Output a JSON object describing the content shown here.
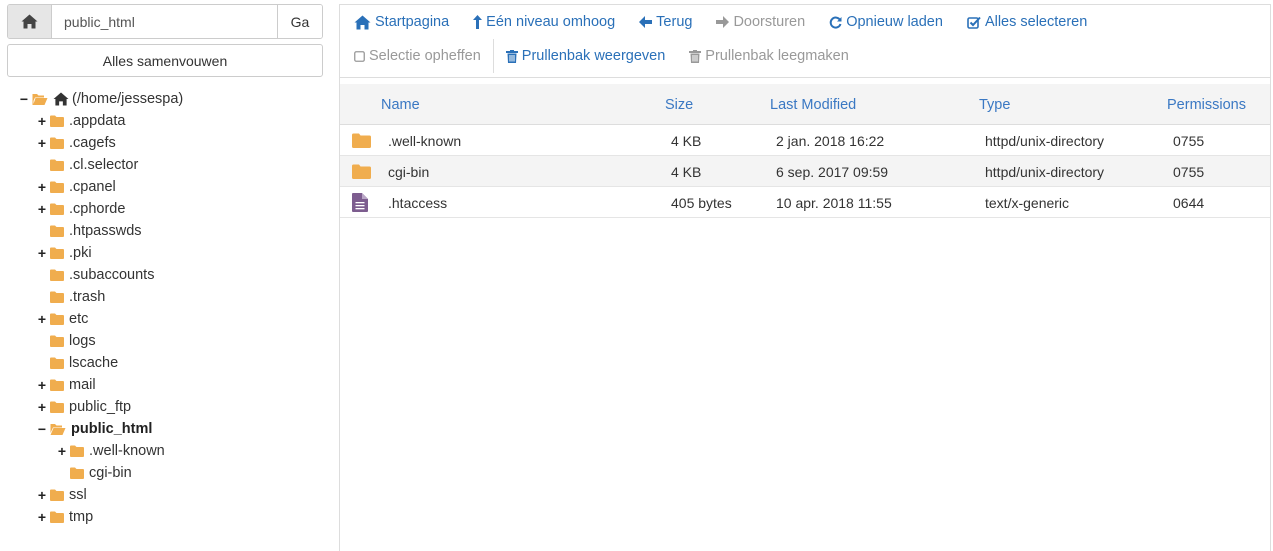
{
  "path_bar": {
    "home_icon": "home-icon",
    "path_value": "public_html",
    "go_label": "Ga"
  },
  "collapse_all_label": "Alles samenvouwen",
  "tree": {
    "root": "(/home/jessespa)",
    "items": [
      {
        "label": ".appdata",
        "toggle": "+"
      },
      {
        "label": ".cagefs",
        "toggle": "+"
      },
      {
        "label": ".cl.selector",
        "toggle": ""
      },
      {
        "label": ".cpanel",
        "toggle": "+"
      },
      {
        "label": ".cphorde",
        "toggle": "+"
      },
      {
        "label": ".htpasswds",
        "toggle": ""
      },
      {
        "label": ".pki",
        "toggle": "+"
      },
      {
        "label": ".subaccounts",
        "toggle": ""
      },
      {
        "label": ".trash",
        "toggle": ""
      },
      {
        "label": "etc",
        "toggle": "+"
      },
      {
        "label": "logs",
        "toggle": ""
      },
      {
        "label": "lscache",
        "toggle": ""
      },
      {
        "label": "mail",
        "toggle": "+"
      },
      {
        "label": "public_ftp",
        "toggle": "+"
      },
      {
        "label": "public_html",
        "toggle": "−"
      },
      {
        "label": ".well-known",
        "toggle": "+"
      },
      {
        "label": "cgi-bin",
        "toggle": ""
      },
      {
        "label": "ssl",
        "toggle": "+"
      },
      {
        "label": "tmp",
        "toggle": "+"
      }
    ]
  },
  "toolbar": {
    "home": "Startpagina",
    "up": "Eén niveau omhoog",
    "back": "Terug",
    "forward": "Doorsturen",
    "reload": "Opnieuw laden",
    "select_all": "Alles selecteren",
    "deselect": "Selectie opheffen",
    "view_trash": "Prullenbak weergeven",
    "empty_trash": "Prullenbak leegmaken"
  },
  "table": {
    "headers": {
      "name": "Name",
      "size": "Size",
      "modified": "Last Modified",
      "type": "Type",
      "permissions": "Permissions"
    },
    "rows": [
      {
        "icon": "folder-icon",
        "name": ".well-known",
        "size": "4 KB",
        "modified": "2 jan. 2018 16:22",
        "type": "httpd/unix-directory",
        "perms": "0755"
      },
      {
        "icon": "folder-icon",
        "name": "cgi-bin",
        "size": "4 KB",
        "modified": "6 sep. 2017 09:59",
        "type": "httpd/unix-directory",
        "perms": "0755"
      },
      {
        "icon": "file-text-icon",
        "name": ".htaccess",
        "size": "405 bytes",
        "modified": "10 apr. 2018 11:55",
        "type": "text/x-generic",
        "perms": "0644"
      }
    ]
  },
  "colors": {
    "folder": "#f0ad4e",
    "link": "#2a70b8",
    "header_link": "#3a78c3",
    "file": "#7d5d8f",
    "disabled": "#999999"
  }
}
